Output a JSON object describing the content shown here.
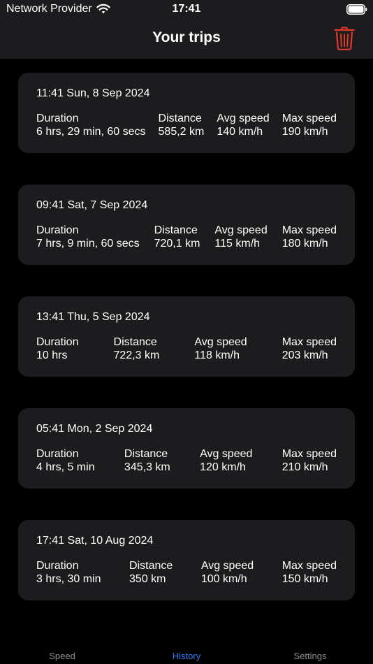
{
  "status_bar": {
    "carrier": "Network Provider",
    "time": "17:41"
  },
  "nav": {
    "title": "Your trips"
  },
  "labels": {
    "duration": "Duration",
    "distance": "Distance",
    "avg_speed": "Avg speed",
    "max_speed": "Max speed"
  },
  "trips": [
    {
      "date": "11:41 Sun, 8 Sep 2024",
      "duration": "6 hrs, 29 min, 60 secs",
      "distance": "585,2 km",
      "avg_speed": "140 km/h",
      "max_speed": "190 km/h"
    },
    {
      "date": "09:41 Sat, 7 Sep 2024",
      "duration": "7 hrs, 9 min, 60 secs",
      "distance": "720,1 km",
      "avg_speed": "115 km/h",
      "max_speed": "180 km/h"
    },
    {
      "date": "13:41 Thu, 5 Sep 2024",
      "duration": "10 hrs",
      "distance": "722,3 km",
      "avg_speed": "118 km/h",
      "max_speed": "203 km/h"
    },
    {
      "date": "05:41 Mon, 2 Sep 2024",
      "duration": "4 hrs, 5 min",
      "distance": "345,3 km",
      "avg_speed": "120 km/h",
      "max_speed": "210 km/h"
    },
    {
      "date": "17:41 Sat, 10 Aug 2024",
      "duration": "3 hrs, 30 min",
      "distance": "350 km",
      "avg_speed": "100 km/h",
      "max_speed": "150 km/h"
    }
  ],
  "tabs": [
    {
      "label": "Speed"
    },
    {
      "label": "History"
    },
    {
      "label": "Settings"
    }
  ],
  "colors": {
    "accent": "#2f7cf6",
    "danger": "#e0392b",
    "card": "#1c1c1e"
  }
}
